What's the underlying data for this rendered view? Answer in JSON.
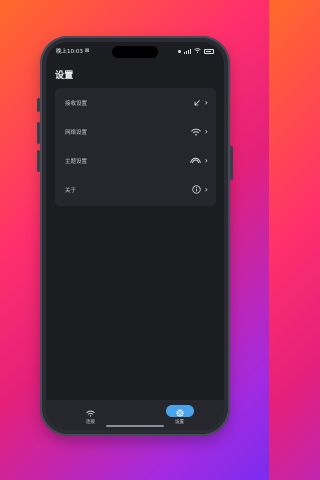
{
  "colors": {
    "bg_gradient_start": "#ff6a2a",
    "bg_gradient_end": "#7a2cf0",
    "screen_bg": "#1c1d21",
    "card_bg": "#25272c",
    "accent": "#4aa3ea"
  },
  "status_bar": {
    "time": "晚上10:03",
    "extra": "⊠"
  },
  "page": {
    "title": "设置"
  },
  "settings": [
    {
      "label": "接收设置",
      "icon": "arrow-down-left-icon"
    },
    {
      "label": "网络设置",
      "icon": "wifi-icon"
    },
    {
      "label": "主题设置",
      "icon": "rainbow-icon"
    },
    {
      "label": "关于",
      "icon": "info-icon"
    }
  ],
  "bottom_nav": [
    {
      "label": "连接",
      "icon": "wifi-icon",
      "active": false
    },
    {
      "label": "设置",
      "icon": "gear-icon",
      "active": true
    }
  ]
}
